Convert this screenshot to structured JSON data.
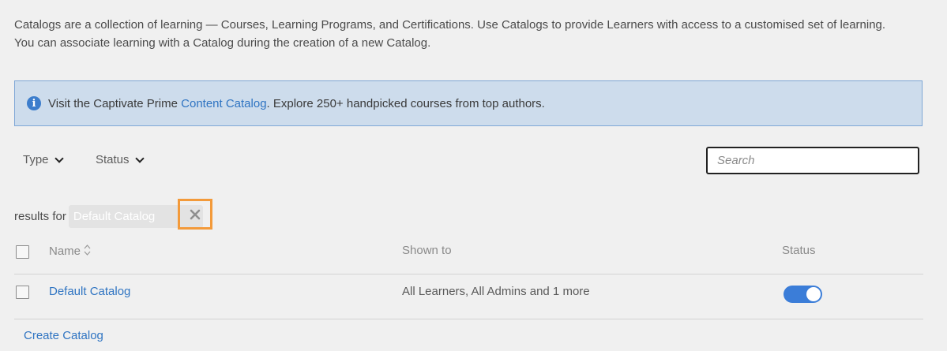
{
  "intro": {
    "line1": "Catalogs are a collection of learning — Courses, Learning Programs, and Certifications. Use Catalogs to provide Learners with access to a customised set of learning.",
    "line2": "You can associate learning with a Catalog during the creation of a new Catalog."
  },
  "banner": {
    "icon": "info-icon",
    "prefix": "Visit the Captivate Prime ",
    "link": "Content Catalog",
    "suffix": ". Explore 250+ handpicked courses from top authors."
  },
  "filters": {
    "type_label": "Type",
    "status_label": "Status"
  },
  "search": {
    "placeholder": "Search",
    "value": ""
  },
  "results": {
    "prefix": "results for",
    "chip_text": "Default Catalog"
  },
  "table": {
    "columns": {
      "name": "Name",
      "shown_to": "Shown to",
      "status": "Status"
    },
    "rows": [
      {
        "name": "Default Catalog",
        "shown_to": "All Learners, All Admins and 1 more",
        "status_on": true
      }
    ]
  },
  "footer": {
    "create_link": "Create Catalog"
  },
  "colors": {
    "accent": "#2f74c2",
    "banner_bg": "#cddcec",
    "toggle_on": "#3b7dd8",
    "highlight": "#f39a3a"
  }
}
